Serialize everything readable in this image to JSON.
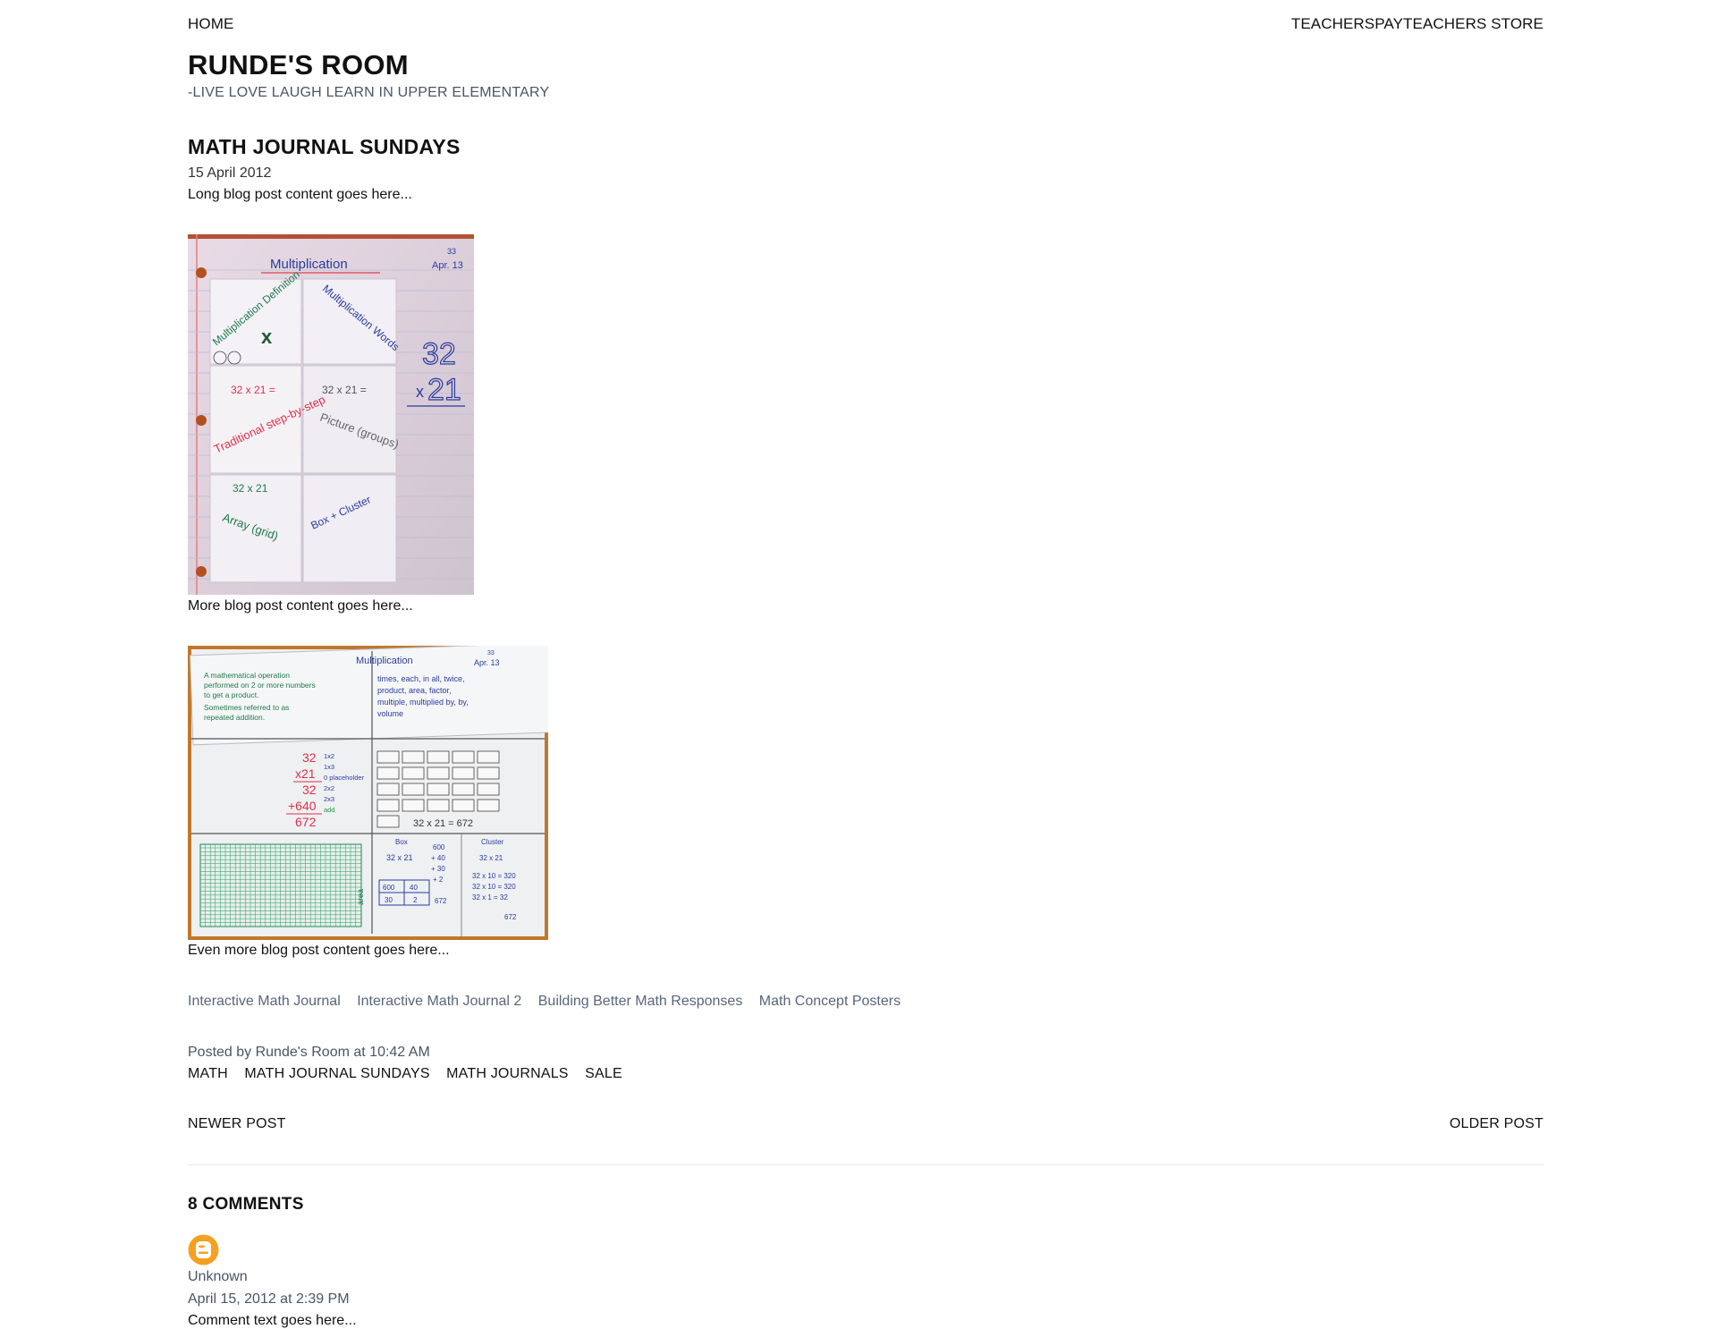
{
  "nav": {
    "home": "HOME",
    "store": "TEACHERSPAYTEACHERS STORE"
  },
  "blog": {
    "title": "RUNDE'S ROOM",
    "description": "-LIVE LOVE LAUGH LEARN IN UPPER ELEMENTARY"
  },
  "post": {
    "title": "MATH JOURNAL SUNDAYS",
    "date": "15 April 2012",
    "body": [
      "Long blog post content goes here...",
      "More blog post content goes here...",
      "Even more blog post content goes here..."
    ],
    "image1": {
      "heading": "Multiplication",
      "page_no": "33",
      "date": "Apr. 13",
      "flaps": [
        "Multiplication Definition",
        "Multiplication Words",
        "32 x 21 =",
        "Traditional step-by-step",
        "32 x 21 =",
        "Picture (groups)",
        "32 x 21",
        "Array (grid)",
        "Box + Cluster"
      ],
      "side_top": "32",
      "side_bottom": "21",
      "times_mark": "x"
    },
    "image2": {
      "heading": "Multiplication",
      "page_no": "33",
      "date": "Apr. 13",
      "definition": [
        "A mathematical operation",
        "performed on 2 or more numbers",
        "to get a product.",
        "Sometimes referred to as",
        "repeated addition."
      ],
      "words": [
        "times, each, in all, twice,",
        "product, area, factor,",
        "multiple, multiplied by, by,",
        "volume"
      ],
      "trad": [
        "32",
        "x21",
        "32",
        "+640",
        "672"
      ],
      "trad_steps": [
        "1x2",
        "1x3",
        "0 placeholder",
        "2x2",
        "2x3",
        "add"
      ],
      "groups_eq": "32 x 21 = 672",
      "box_title": "Box",
      "box_row1": [
        "600",
        "40"
      ],
      "box_row2": [
        "30",
        "2"
      ],
      "box_eq": "32 x 21",
      "box_sum": [
        "600",
        "+ 40",
        "+ 30",
        "+ 2",
        "672"
      ],
      "cluster_title": "Cluster",
      "cluster_lines": [
        "32 x 21",
        "32 x 10 = 320",
        "32 x 10 = 320",
        "32 x 1 = 32",
        "672"
      ],
      "grid_label": "area"
    },
    "related": [
      "Interactive Math Journal",
      "Interactive Math Journal 2",
      "Building Better Math Responses",
      "Math Concept Posters"
    ],
    "byline": "Posted by Runde's Room at 10:42 AM",
    "labels": [
      "MATH",
      "MATH JOURNAL SUNDAYS",
      "MATH JOURNALS",
      "SALE"
    ]
  },
  "pager": {
    "newer": "NEWER POST",
    "older": "OLDER POST"
  },
  "comments": {
    "title": "8 COMMENTS",
    "items": [
      {
        "author": "Unknown",
        "date": "April 15, 2012 at 2:39 PM",
        "text": "Comment text goes here..."
      }
    ]
  },
  "colors": {
    "accent_link": "#58667a",
    "muted_text": "#4a5565",
    "avatar_orange": "#f5a020"
  }
}
